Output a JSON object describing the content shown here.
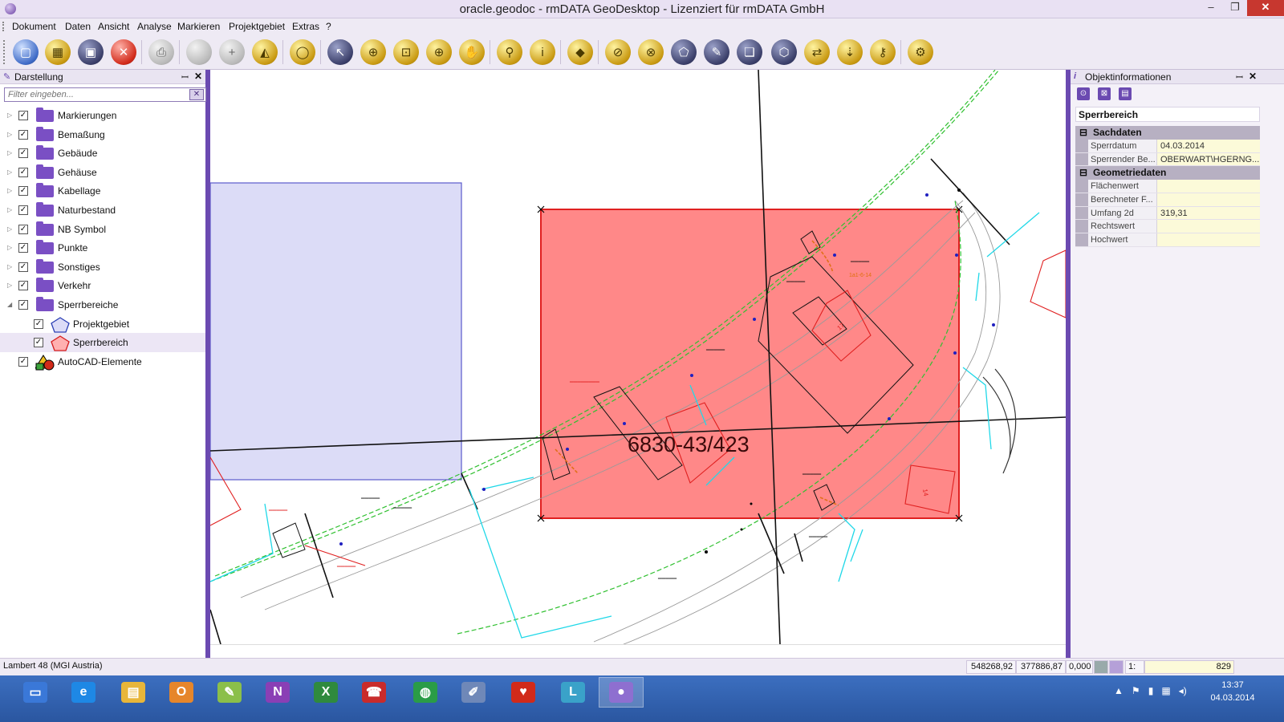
{
  "window": {
    "title": "oracle.geodoc - rmDATA GeoDesktop - Lizenziert für rmDATA GmbH",
    "min": "–",
    "max": "❐",
    "close": "✕"
  },
  "menu": [
    "Dokument",
    "Daten",
    "Ansicht",
    "Analyse",
    "Markieren",
    "Projektgebiet",
    "Extras",
    "?"
  ],
  "toolbar": {
    "tools": [
      {
        "name": "new-document",
        "glyph": "▢",
        "style": "blue"
      },
      {
        "name": "open-document",
        "glyph": "▦",
        "style": "gold"
      },
      {
        "name": "save-document",
        "glyph": "▣",
        "style": "dark"
      },
      {
        "name": "close-document",
        "glyph": "✕",
        "style": "red"
      },
      {
        "name": "print",
        "glyph": "⎙",
        "style": "grey"
      },
      {
        "name": "disabled-circle",
        "glyph": "",
        "style": "grey"
      },
      {
        "name": "disabled-add",
        "glyph": "+",
        "style": "grey"
      },
      {
        "name": "draw-shape",
        "glyph": "◭",
        "style": "gold"
      },
      {
        "name": "draw-circle",
        "glyph": "◯",
        "style": "gold"
      },
      {
        "name": "select-pointer",
        "glyph": "↖",
        "style": "dark"
      },
      {
        "name": "zoom-extent",
        "glyph": "⊕",
        "style": "gold"
      },
      {
        "name": "zoom-window",
        "glyph": "⊡",
        "style": "gold"
      },
      {
        "name": "zoom-in",
        "glyph": "⊕",
        "style": "gold"
      },
      {
        "name": "pan-hand",
        "glyph": "✋",
        "style": "gold"
      },
      {
        "name": "search-object",
        "glyph": "⚲",
        "style": "gold"
      },
      {
        "name": "object-info",
        "glyph": "i",
        "style": "gold"
      },
      {
        "name": "geodoc",
        "glyph": "◆",
        "style": "gold"
      },
      {
        "name": "measure-line",
        "glyph": "⊘",
        "style": "gold"
      },
      {
        "name": "measure-area",
        "glyph": "⊗",
        "style": "gold"
      },
      {
        "name": "select-polygon",
        "glyph": "⬠",
        "style": "dark"
      },
      {
        "name": "edit-polygon",
        "glyph": "✎",
        "style": "dark"
      },
      {
        "name": "copy-polygon",
        "glyph": "❏",
        "style": "dark"
      },
      {
        "name": "area-tool",
        "glyph": "⬡",
        "style": "dark"
      },
      {
        "name": "transfer-data",
        "glyph": "⇄",
        "style": "gold"
      },
      {
        "name": "import-data",
        "glyph": "⇣",
        "style": "gold"
      },
      {
        "name": "key-tool",
        "glyph": "⚷",
        "style": "gold"
      },
      {
        "name": "settings-tool",
        "glyph": "⚙",
        "style": "gold"
      }
    ]
  },
  "left_panel": {
    "title": "Darstellung",
    "pin": "ꟷ",
    "close": "✕",
    "filter_placeholder": "Filter eingeben...",
    "filter_clear": "✕",
    "layers": [
      {
        "label": "Markierungen",
        "type": "folder",
        "checked": true
      },
      {
        "label": "Bemaßung",
        "type": "folder",
        "checked": true
      },
      {
        "label": "Gebäude",
        "type": "folder",
        "checked": true
      },
      {
        "label": "Gehäuse",
        "type": "folder",
        "checked": true
      },
      {
        "label": "Kabellage",
        "type": "folder",
        "checked": true
      },
      {
        "label": "Naturbestand",
        "type": "folder",
        "checked": true
      },
      {
        "label": "NB Symbol",
        "type": "folder",
        "checked": true
      },
      {
        "label": "Punkte",
        "type": "folder",
        "checked": true
      },
      {
        "label": "Sonstiges",
        "type": "folder",
        "checked": true
      },
      {
        "label": "Verkehr",
        "type": "folder",
        "checked": true
      },
      {
        "label": "Sperrbereiche",
        "type": "folder",
        "checked": true,
        "expanded": true
      },
      {
        "label": "Projektgebiet",
        "type": "blue-polygon",
        "checked": true,
        "child": true
      },
      {
        "label": "Sperrbereich",
        "type": "red-polygon",
        "checked": true,
        "child": true,
        "selected": true
      },
      {
        "label": "AutoCAD-Elemente",
        "type": "autocad",
        "checked": true
      }
    ]
  },
  "map": {
    "parcel_label": "6830-43/423",
    "small_labels": [
      "17",
      "14",
      "1a1-6-14"
    ]
  },
  "right_panel": {
    "title": "Objektinformationen",
    "pin": "ꟷ",
    "close": "✕",
    "object_name": "Sperrbereich",
    "sections": [
      {
        "title": "Sachdaten",
        "rows": [
          {
            "name": "Sperrdatum",
            "value": "04.03.2014"
          },
          {
            "name": "Sperrender Be...",
            "value": "OBERWART\\HGERNG..."
          }
        ]
      },
      {
        "title": "Geometriedaten",
        "rows": [
          {
            "name": "Flächenwert",
            "value": ""
          },
          {
            "name": "Berechneter F...",
            "value": ""
          },
          {
            "name": "Umfang 2d",
            "value": "319,31"
          },
          {
            "name": "Rechtswert",
            "value": ""
          },
          {
            "name": "Hochwert",
            "value": ""
          }
        ]
      }
    ]
  },
  "statusbar": {
    "crs": "Lambert 48 (MGI Austria)",
    "x": "548268,92",
    "y": "377886,87",
    "z": "0,000",
    "scale_prefix": "1:",
    "scale": "829"
  },
  "taskbar": {
    "apps": [
      {
        "name": "desktop",
        "glyph": "▭",
        "color": "#3a78d8"
      },
      {
        "name": "internet-explorer",
        "glyph": "e",
        "color": "#1e88e5"
      },
      {
        "name": "file-explorer",
        "glyph": "▤",
        "color": "#e8b63a"
      },
      {
        "name": "outlook",
        "glyph": "O",
        "color": "#e6862b"
      },
      {
        "name": "notepad-edit",
        "glyph": "✎",
        "color": "#8bbf4a"
      },
      {
        "name": "onenote",
        "glyph": "N",
        "color": "#8a3fb5"
      },
      {
        "name": "excel",
        "glyph": "X",
        "color": "#2f8a3e"
      },
      {
        "name": "phone",
        "glyph": "☎",
        "color": "#c92b2b"
      },
      {
        "name": "globe",
        "glyph": "◍",
        "color": "#2a9c47"
      },
      {
        "name": "notes",
        "glyph": "✐",
        "color": "#6f88b8"
      },
      {
        "name": "pepper-app",
        "glyph": "♥",
        "color": "#d12a1a"
      },
      {
        "name": "network-tool",
        "glyph": "L",
        "color": "#3aa2c9"
      },
      {
        "name": "geodesktop",
        "glyph": "●",
        "color": "#8e6fd0"
      }
    ],
    "time": "13:37",
    "date": "04.03.2014"
  }
}
